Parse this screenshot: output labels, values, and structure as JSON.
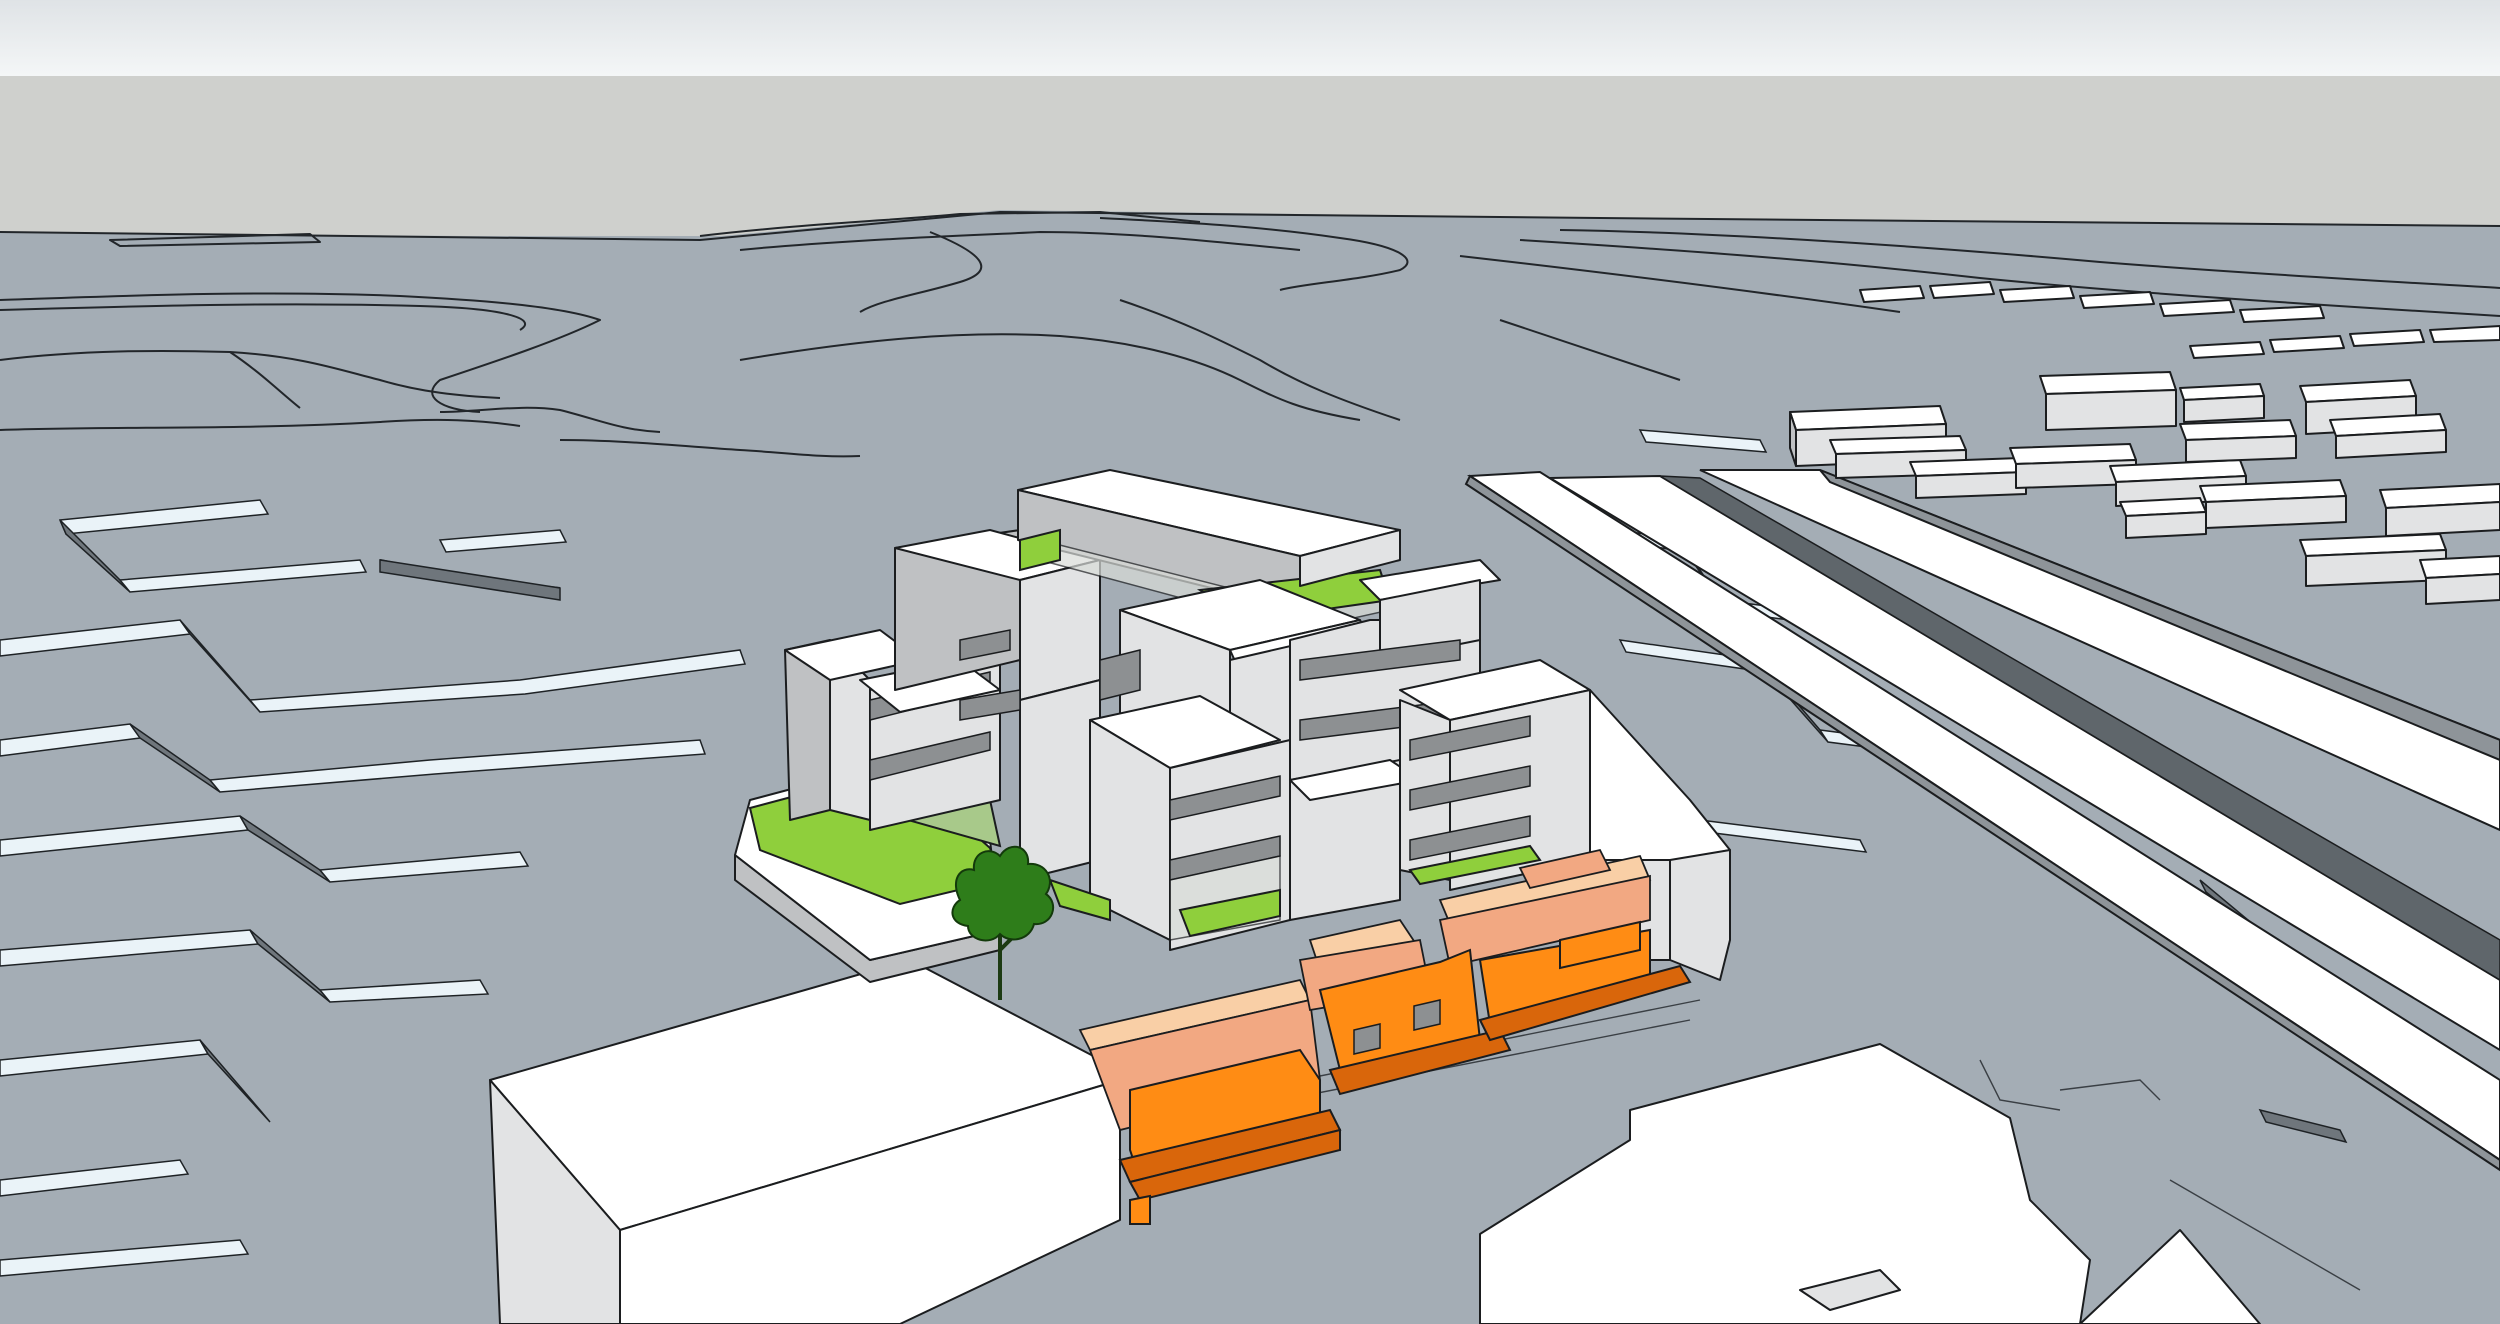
{
  "scene": {
    "type": "3d-massing-model",
    "colors": {
      "ground": "#a4adb5",
      "haze": "#cfd0cd",
      "massing_white": "#ffffff",
      "massing_shade": "#bfc1c3",
      "landscape_green": "#8fcf3c",
      "retail_orange": "#ff8c14",
      "retail_salmon": "#f2a882",
      "tree_green": "#2e7d1a"
    }
  }
}
